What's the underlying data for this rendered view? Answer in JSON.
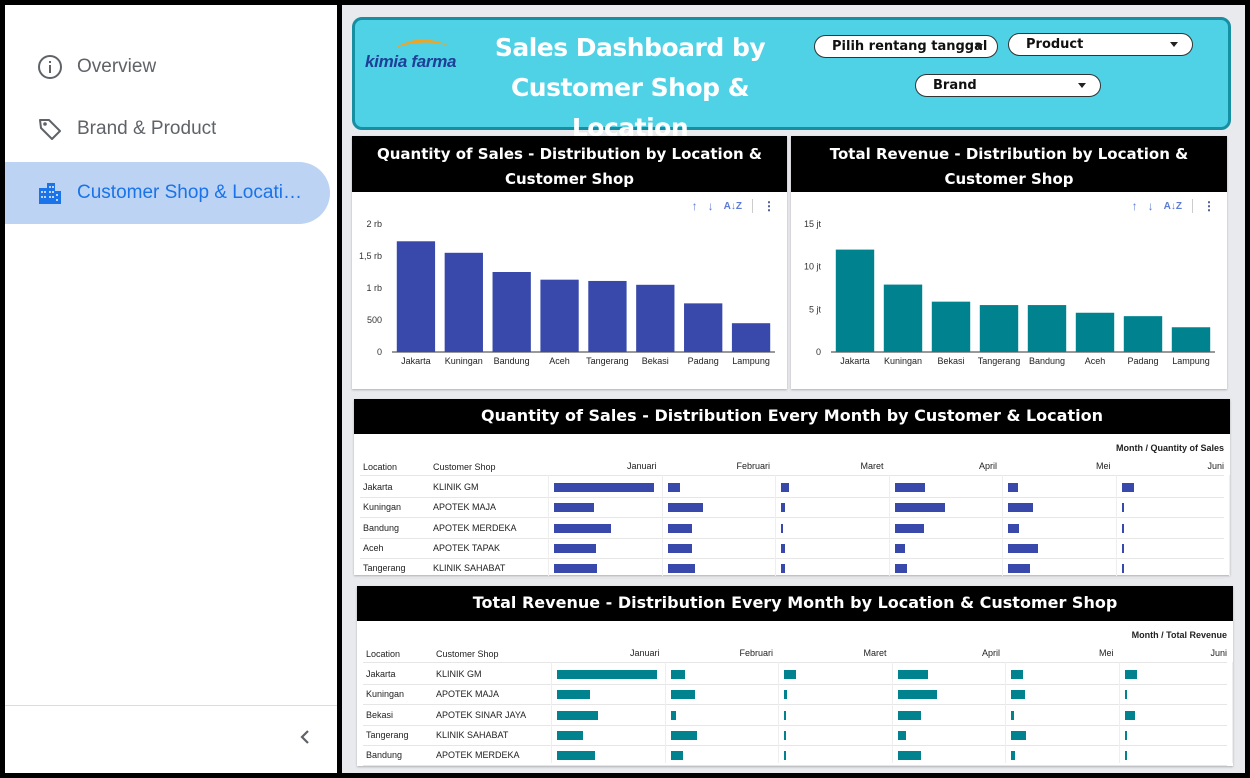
{
  "sidebar": {
    "items": [
      {
        "label": "Overview",
        "icon": "info-icon"
      },
      {
        "label": "Brand & Product",
        "icon": "tag-icon"
      },
      {
        "label": "Customer Shop & Locati…",
        "icon": "building-icon",
        "active": true
      }
    ]
  },
  "header": {
    "logo_text": "kimia farma",
    "title_line1": "Sales Dashboard by",
    "title_line2": "Customer Shop & Location",
    "date_range": "Pilih rentang tanggal",
    "product": "Product",
    "brand": "Brand"
  },
  "colors": {
    "accent_cyan": "#4fd1e6",
    "bar_blue": "#3949ab",
    "bar_teal": "#00838f",
    "active_nav": "#bcd3f3"
  },
  "chart1": {
    "title": "Quantity of Sales - Distribution by Location & Customer Shop"
  },
  "chart2": {
    "title": "Total Revenue   - Distribution by Location & Customer Shop"
  },
  "table1": {
    "title": "Quantity of Sales - Distribution Every Month by Customer & Location",
    "corner": "Month / Quantity of Sales",
    "col_location": "Location",
    "col_shop": "Customer Shop",
    "months": [
      "Januari",
      "Februari",
      "Maret",
      "April",
      "Mei",
      "Juni"
    ],
    "rows": [
      {
        "location": "Jakarta",
        "shop": "KLINIK GM",
        "values": [
          1.0,
          0.12,
          0.08,
          0.3,
          0.1,
          0.12
        ]
      },
      {
        "location": "Kuningan",
        "shop": "APOTEK MAJA",
        "values": [
          0.4,
          0.35,
          0.04,
          0.5,
          0.25,
          0.02
        ]
      },
      {
        "location": "Bandung",
        "shop": "APOTEK MERDEKA",
        "values": [
          0.57,
          0.24,
          0.02,
          0.29,
          0.11,
          0.01
        ]
      },
      {
        "location": "Aceh",
        "shop": "APOTEK TAPAK",
        "values": [
          0.42,
          0.24,
          0.04,
          0.1,
          0.3,
          0.02
        ]
      },
      {
        "location": "Tangerang",
        "shop": "KLINIK SAHABAT",
        "values": [
          0.43,
          0.27,
          0.04,
          0.12,
          0.22,
          0.01
        ]
      }
    ]
  },
  "table2": {
    "title": "Total Revenue - Distribution Every Month by Location & Customer Shop",
    "corner": "Month / Total Revenue",
    "col_location": "Location",
    "col_shop": "Customer Shop",
    "months": [
      "Januari",
      "Februari",
      "Maret",
      "April",
      "Mei",
      "Juni"
    ],
    "rows": [
      {
        "location": "Jakarta",
        "shop": "KLINIK GM",
        "values": [
          1.0,
          0.14,
          0.12,
          0.3,
          0.12,
          0.12
        ]
      },
      {
        "location": "Kuningan",
        "shop": "APOTEK MAJA",
        "values": [
          0.33,
          0.24,
          0.03,
          0.39,
          0.14,
          0.02
        ]
      },
      {
        "location": "Bekasi",
        "shop": "APOTEK SINAR JAYA",
        "values": [
          0.41,
          0.05,
          0.02,
          0.23,
          0.03,
          0.1
        ]
      },
      {
        "location": "Tangerang",
        "shop": "KLINIK SAHABAT",
        "values": [
          0.26,
          0.26,
          0.02,
          0.08,
          0.15,
          0.01
        ]
      },
      {
        "location": "Bandung",
        "shop": "APOTEK MERDEKA",
        "values": [
          0.38,
          0.12,
          0.02,
          0.23,
          0.04,
          0.01
        ]
      }
    ]
  },
  "chart_data": [
    {
      "type": "bar",
      "title": "Quantity of Sales - Distribution by Location & Customer Shop",
      "categories": [
        "Jakarta",
        "Kuningan",
        "Bandung",
        "Aceh",
        "Tangerang",
        "Bekasi",
        "Padang",
        "Lampung"
      ],
      "values": [
        1730,
        1550,
        1250,
        1130,
        1110,
        1050,
        760,
        450
      ],
      "ylim": [
        0,
        2000
      ],
      "yticks": [
        "0",
        "500",
        "1 rb",
        "1,5 rb",
        "2 rb"
      ],
      "ytick_values": [
        0,
        500,
        1000,
        1500,
        2000
      ],
      "color": "#3949ab",
      "grid": false
    },
    {
      "type": "bar",
      "title": "Total Revenue   - Distribution by Location & Customer Shop",
      "categories": [
        "Jakarta",
        "Kuningan",
        "Bekasi",
        "Tangerang",
        "Bandung",
        "Aceh",
        "Padang",
        "Lampung"
      ],
      "values": [
        12000000,
        7900000,
        5900000,
        5500000,
        5500000,
        4600000,
        4200000,
        2900000
      ],
      "ylim": [
        0,
        15000000
      ],
      "yticks": [
        "0",
        "5 jt",
        "10 jt",
        "15 jt"
      ],
      "ytick_values": [
        0,
        5000000,
        10000000,
        15000000
      ],
      "color": "#00838f",
      "grid": false
    }
  ]
}
